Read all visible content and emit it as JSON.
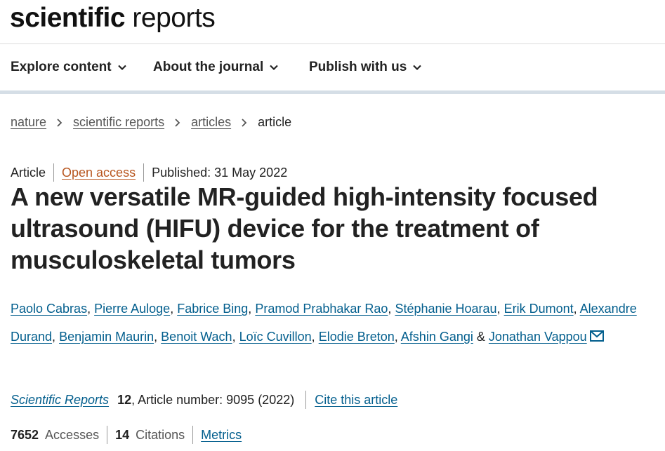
{
  "header": {
    "logo_bold": "scientific",
    "logo_light": "reports"
  },
  "nav": {
    "items": [
      {
        "label": "Explore content",
        "icon": "chevron-down-icon"
      },
      {
        "label": "About the journal",
        "icon": "chevron-down-icon"
      },
      {
        "label": "Publish with us",
        "icon": "chevron-down-icon"
      }
    ]
  },
  "breadcrumb": {
    "items": [
      "nature",
      "scientific reports",
      "articles"
    ],
    "current": "article"
  },
  "article": {
    "type": "Article",
    "access": "Open access",
    "published": "Published: 31 May 2022",
    "title": "A new versatile MR-guided high-intensity focused ultrasound (HIFU) device for the treatment of musculoskeletal tumors",
    "authors": [
      "Paolo Cabras",
      "Pierre Auloge",
      "Fabrice Bing",
      "Pramod Prabhakar Rao",
      "Stéphanie Hoarau",
      "Erik Dumont",
      "Alexandre Durand",
      "Benjamin Maurin",
      "Benoit Wach",
      "Loïc Cuvillon",
      "Elodie Breton",
      "Afshin Gangi",
      "Jonathan Vappou"
    ],
    "author_separator": ",",
    "author_last_joiner": "&",
    "corresponding_icon": "mail-icon",
    "journal": "Scientific Reports",
    "volume": "12",
    "article_number": ", Article number: 9095 (2022)",
    "cite_label": "Cite this article",
    "accesses_count": "7652",
    "accesses_label": "Accesses",
    "citations_count": "14",
    "citations_label": "Citations",
    "metrics_label": "Metrics"
  },
  "colors": {
    "link": "#025e8d",
    "open_access": "#b8561f",
    "nav_border": "#d5dee6"
  }
}
